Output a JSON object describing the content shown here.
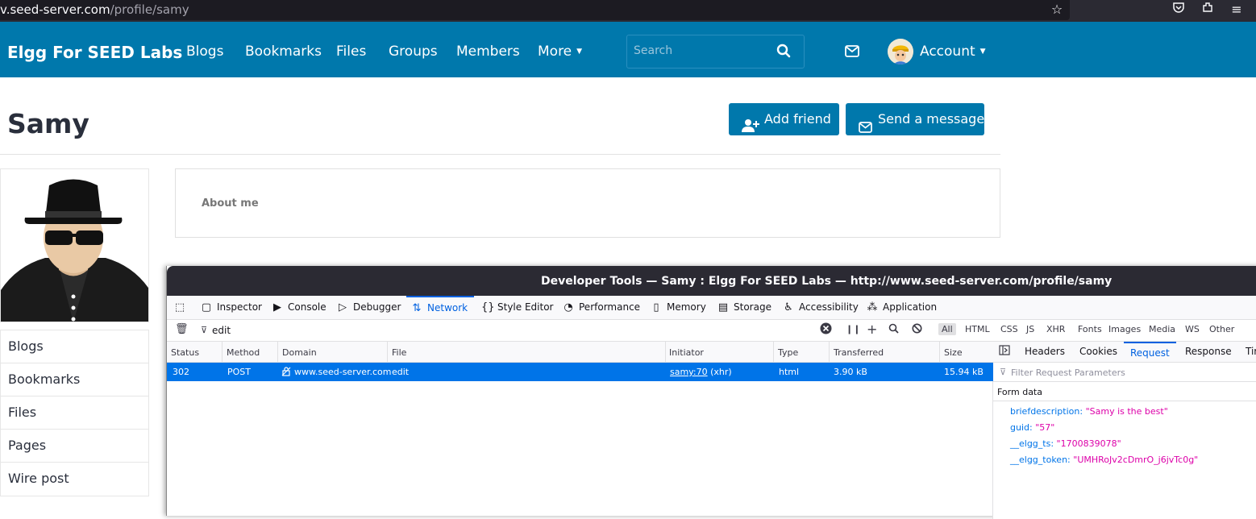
{
  "browser": {
    "url_prefix": "v.seed-server.com",
    "url_path": "/profile/samy"
  },
  "nav": {
    "brand": "Elgg For SEED Labs",
    "items": [
      "Blogs",
      "Bookmarks",
      "Files",
      "Groups",
      "Members",
      "More"
    ],
    "search_placeholder": "Search",
    "account_label": "Account"
  },
  "profile": {
    "name": "Samy",
    "add_friend_label": "Add friend",
    "send_message_label": "Send a message",
    "about_title": "About me",
    "sidebar_items": [
      "Blogs",
      "Bookmarks",
      "Files",
      "Pages",
      "Wire post"
    ]
  },
  "devtools": {
    "title": "Developer Tools — Samy : Elgg For SEED Labs — http://www.seed-server.com/profile/samy",
    "tabs": [
      "Inspector",
      "Console",
      "Debugger",
      "Network",
      "Style Editor",
      "Performance",
      "Memory",
      "Storage",
      "Accessibility",
      "Application"
    ],
    "active_tab": "Network",
    "filter_value": "edit",
    "type_filters": [
      "All",
      "HTML",
      "CSS",
      "JS",
      "XHR",
      "Fonts",
      "Images",
      "Media",
      "WS",
      "Other"
    ],
    "columns": [
      "Status",
      "Method",
      "Domain",
      "File",
      "Initiator",
      "Type",
      "Transferred",
      "Size"
    ],
    "request": {
      "status": "302",
      "method": "POST",
      "domain": "www.seed-server.com",
      "file": "edit",
      "initiator_link": "samy:70",
      "initiator_type": "(xhr)",
      "type": "html",
      "transferred": "3.90 kB",
      "size": "15.94 kB"
    },
    "side_tabs": [
      "Headers",
      "Cookies",
      "Request",
      "Response",
      "Tir"
    ],
    "active_side_tab": "Request",
    "param_filter_placeholder": "Filter Request Parameters",
    "form_data_label": "Form data",
    "params": [
      {
        "key": "briefdescription:",
        "value": "\"Samy is the best\""
      },
      {
        "key": "guid:",
        "value": "\"57\""
      },
      {
        "key": "__elgg_ts:",
        "value": "\"1700839078\""
      },
      {
        "key": "__elgg_token:",
        "value": "\"UMHRoJv2cDmrO_j6jvTc0g\""
      }
    ]
  },
  "colors": {
    "elgg_blue": "#0078ac",
    "devtools_accent": "#0061e0",
    "selected_row": "#0074e8",
    "param_key": "#0074e8",
    "param_value": "#dd00a9"
  }
}
